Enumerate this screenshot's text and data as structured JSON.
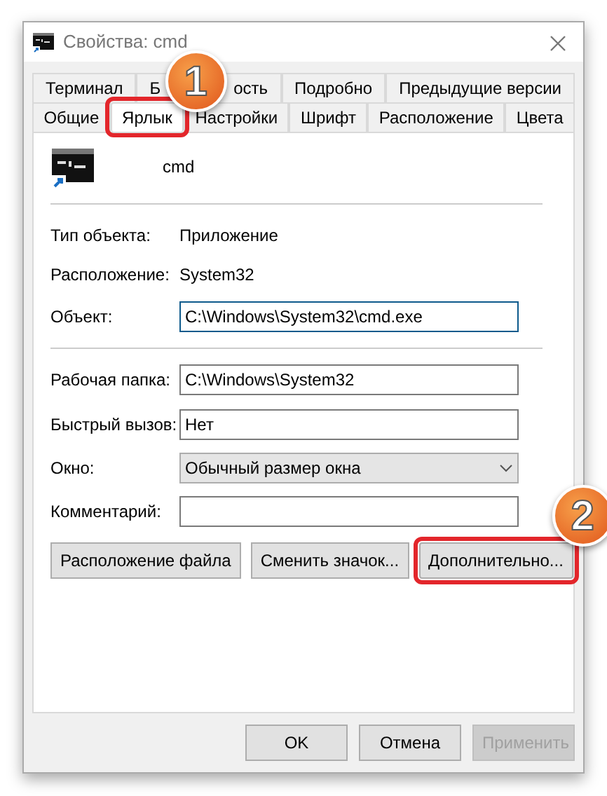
{
  "window": {
    "title": "Свойства: cmd"
  },
  "tab_rows": [
    [
      {
        "label": "Терминал",
        "selected": false
      },
      {
        "label_parts": [
          "Б",
          "ость"
        ],
        "selected": false
      },
      {
        "label": "Подробно",
        "selected": false
      },
      {
        "label": "Предыдущие версии",
        "selected": false
      }
    ],
    [
      {
        "label": "Общие",
        "selected": false
      },
      {
        "label": "Ярлык",
        "selected": true,
        "callout": "1"
      },
      {
        "label": "Настройки",
        "selected": false
      },
      {
        "label": "Шрифт",
        "selected": false
      },
      {
        "label": "Расположение",
        "selected": false
      },
      {
        "label": "Цвета",
        "selected": false
      }
    ]
  ],
  "header": {
    "name": "cmd"
  },
  "info": [
    {
      "label": "Тип объекта:",
      "value": "Приложение"
    },
    {
      "label": "Расположение:",
      "value": "System32"
    }
  ],
  "fields": [
    {
      "kind": "text",
      "label": "Объект:",
      "value": "C:\\Windows\\System32\\cmd.exe",
      "focused": true
    },
    {
      "kind": "separator"
    },
    {
      "kind": "text",
      "label": "Рабочая папка:",
      "value": "C:\\Windows\\System32",
      "focused": false
    },
    {
      "kind": "text",
      "label": "Быстрый вызов:",
      "value": "Нет",
      "focused": false
    },
    {
      "kind": "select",
      "label": "Окно:",
      "value": "Обычный размер окна"
    },
    {
      "kind": "text",
      "label": "Комментарий:",
      "focused": false
    }
  ],
  "action_buttons": [
    {
      "label": "Расположение файла"
    },
    {
      "label": "Сменить значок..."
    },
    {
      "label": "Дополнительно...",
      "callout": "2"
    }
  ],
  "dialog_buttons": [
    {
      "label": "OK",
      "disabled": false
    },
    {
      "label": "Отмена",
      "disabled": false
    },
    {
      "label": "Применить",
      "disabled": true
    }
  ]
}
